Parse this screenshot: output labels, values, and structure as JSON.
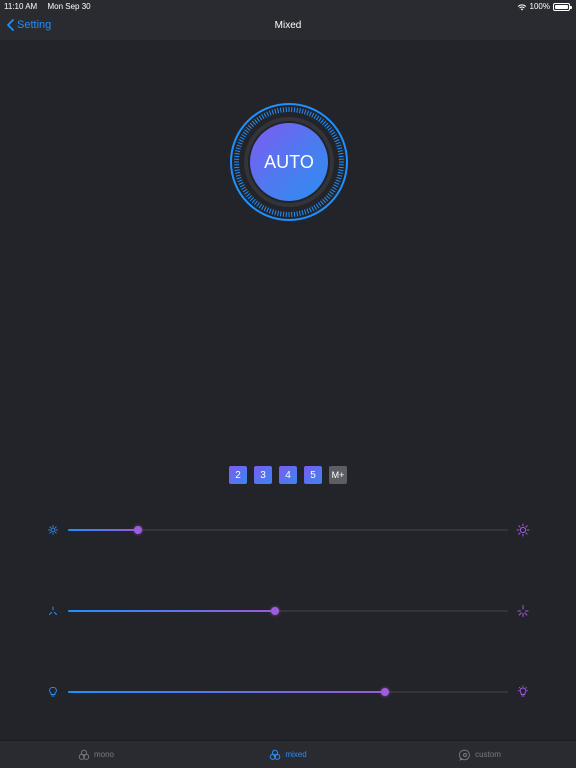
{
  "status_bar": {
    "time": "11:10 AM",
    "date": "Mon Sep 30",
    "battery": "100%",
    "battery_level": 1.0
  },
  "nav": {
    "back_label": "Setting",
    "title": "Mixed"
  },
  "auto_button": {
    "label": "AUTO"
  },
  "mode_buttons": [
    "2",
    "3",
    "4",
    "5",
    "M+"
  ],
  "sliders": [
    {
      "name": "brightness",
      "value": 0.16
    },
    {
      "name": "color-temperature",
      "value": 0.47
    },
    {
      "name": "bulb-intensity",
      "value": 0.72
    }
  ],
  "tabs": [
    {
      "label": "mono",
      "icon": "mono-icon",
      "active": false
    },
    {
      "label": "mixed",
      "icon": "mixed-icon",
      "active": true
    },
    {
      "label": "custom",
      "icon": "custom-icon",
      "active": false
    }
  ],
  "colors": {
    "accent_blue": "#1e90ff",
    "accent_purple": "#9b59d6",
    "background": "#232429"
  }
}
